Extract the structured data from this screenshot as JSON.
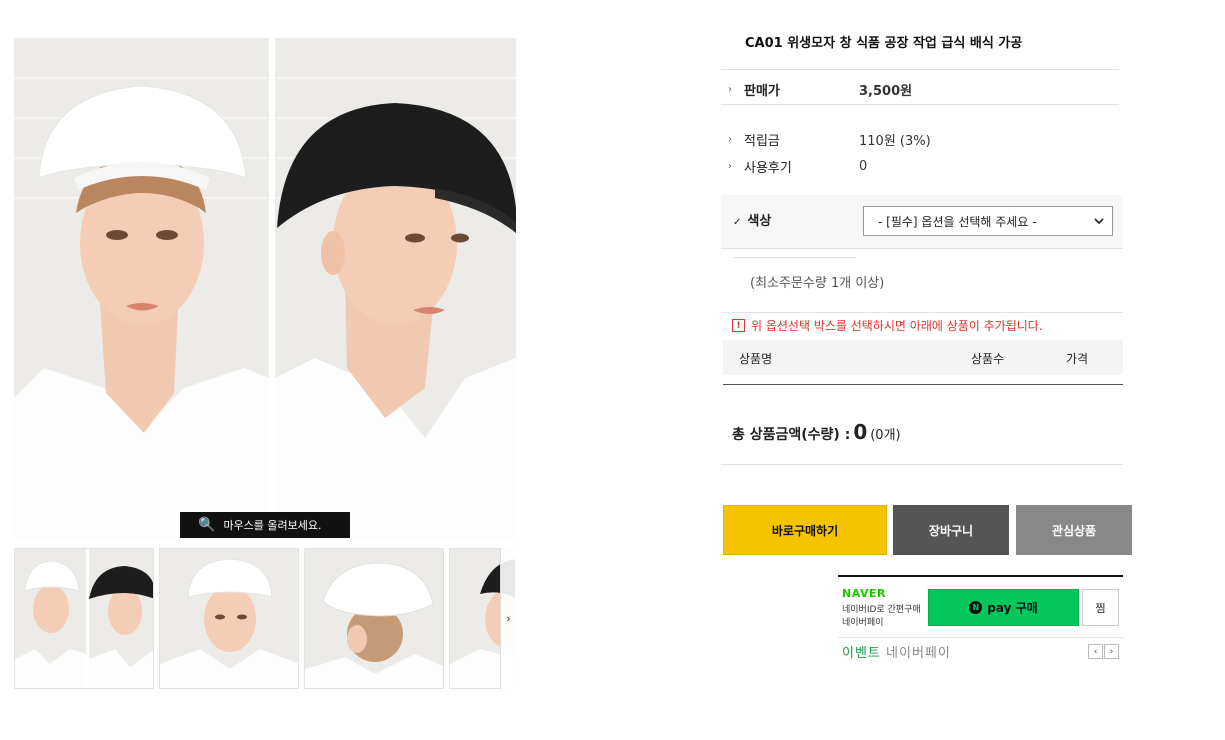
{
  "product": {
    "title": "CA01 위생모자 창 식품 공장 작업 급식 배식 가공"
  },
  "gallery": {
    "zoom_hint": "마우스를 올려보세요.",
    "next_arrow": "›"
  },
  "info": {
    "price_label": "판매가",
    "price_value": "3,500원",
    "points_label": "적립금",
    "points_value": "110원 (3%)",
    "reviews_label": "사용후기",
    "reviews_value": "0"
  },
  "option": {
    "label": "색상",
    "select_value": "- [필수] 옵션을 선택해 주세요 -"
  },
  "min_order": "(최소주문수량 1개 이상)",
  "notice": "위 옵션선택 박스를 선택하시면 아래에 상품이 추가됩니다.",
  "cart_table": {
    "col_name": "상품명",
    "col_qty": "상품수",
    "col_price": "가격"
  },
  "total": {
    "label": "총 상품금액(수량) :",
    "amount": "0",
    "count": "(0개)"
  },
  "buttons": {
    "buy": "바로구매하기",
    "cart": "장바구니",
    "wish": "관심상품"
  },
  "npay": {
    "brand": "NAVER",
    "sub1": "네이버ID로 간편구매",
    "sub2": "네이버페이",
    "pay_label": "pay 구매",
    "n_mark": "N",
    "jjim": "찜",
    "event_em": "이벤트",
    "event_text": "네이버페이",
    "prev": "‹",
    "next": "›"
  },
  "colors": {
    "buy_button": "#f6c300",
    "cart_button": "#555555",
    "wish_button": "#888888",
    "npay_green": "#03c75a",
    "notice_red": "#dd3333"
  }
}
